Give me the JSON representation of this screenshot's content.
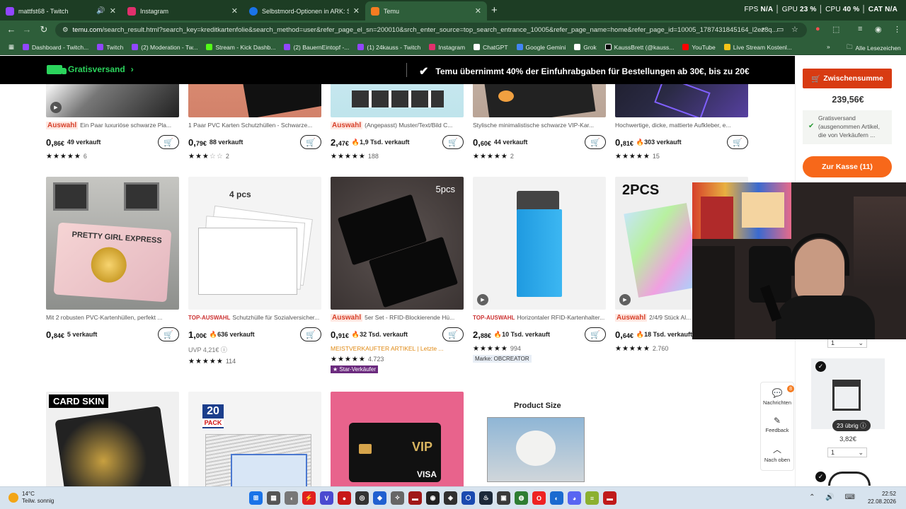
{
  "browser": {
    "tabs": [
      {
        "title": "mattfst68 - Twitch",
        "color": "#9146ff",
        "audio": true,
        "active": false
      },
      {
        "title": "Instagram",
        "color": "#e1306c",
        "audio": false,
        "active": false
      },
      {
        "title": "Selbstmord-Optionen in ARK: Su",
        "color": "#1a73e8",
        "audio": false,
        "active": false
      },
      {
        "title": "Temu",
        "color": "#f57c21",
        "audio": false,
        "active": true
      }
    ],
    "new_tab": "+",
    "perf": {
      "fps_label": "FPS",
      "fps": "N/A",
      "gpu_label": "GPU",
      "gpu": "23 %",
      "cpu_label": "CPU",
      "cpu": "40 %",
      "extra": "CAT N/A"
    },
    "url_host": "temu.com",
    "url_path": "/search_result.html?search_key=kreditkartenfolie&search_method=user&refer_page_el_sn=200010&srch_enter_source=top_search_entrance_10005&refer_page_name=home&refer_page_id=10005_1787431845164_l2ez8q...",
    "bookmarks": [
      {
        "label": "Dashboard - Twitch...",
        "color": "#9146ff"
      },
      {
        "label": "Twitch",
        "color": "#9146ff"
      },
      {
        "label": "(2) Moderation - Tw...",
        "color": "#9146ff"
      },
      {
        "label": "Stream - Kick Dashb...",
        "color": "#53fc18"
      },
      {
        "label": "(2) BauernEintopf -...",
        "color": "#9146ff"
      },
      {
        "label": "(1) 24kauss - Twitch",
        "color": "#9146ff"
      },
      {
        "label": "Instagram",
        "color": "#e1306c"
      },
      {
        "label": "ChatGPT",
        "color": "#ffffff"
      },
      {
        "label": "Google Gemini",
        "color": "#4285f4"
      },
      {
        "label": "Grok",
        "color": "#ffffff"
      },
      {
        "label": "KaussBrett (@kauss...",
        "color": "#000000"
      },
      {
        "label": "YouTube",
        "color": "#ff0000"
      },
      {
        "label": "Live Stream Kostenl...",
        "color": "#f5c518"
      }
    ],
    "bookmarks_more": "»",
    "all_bookmarks": "Alle Lesezeichen"
  },
  "banner": {
    "shipping": "Gratisversand",
    "promo": "Temu übernimmt 40% der Einfuhrabgaben für Bestellungen ab 30€, bis zu 20€"
  },
  "products_row1": [
    {
      "tag": "Auswahl",
      "title": "Ein Paar luxuriöse schwarze Pla...",
      "price_int": "0,",
      "price_dec": "86€",
      "sold": "49 verkauft",
      "stars": 5,
      "count": "6"
    },
    {
      "tag": "",
      "title": "1 Paar PVC Karten Schutzhüllen - Schwarze...",
      "price_int": "0,",
      "price_dec": "79€",
      "sold": "88 verkauft",
      "stars": 3,
      "count": "2"
    },
    {
      "tag": "Auswahl",
      "title": "(Angepasst) Muster/Text/Bild C...",
      "price_int": "2,",
      "price_dec": "47€",
      "sold": "1,9 Tsd. verkauft",
      "stars": 5,
      "count": "188"
    },
    {
      "tag": "",
      "title": "Stylische minimalistische schwarze VIP-Kar...",
      "price_int": "0,",
      "price_dec": "60€",
      "sold": "44 verkauft",
      "stars": 5,
      "count": "2"
    },
    {
      "tag": "",
      "title": "Hochwertige, dicke, mattierte Aufkleber, e...",
      "price_int": "0,",
      "price_dec": "81€",
      "sold": "303 verkauft",
      "stars": 5,
      "count": "15"
    }
  ],
  "products_row2": [
    {
      "tag": "",
      "title": "Mit 2 robusten PVC-Kartenhüllen, perfekt ...",
      "price_int": "0,",
      "price_dec": "84€",
      "sold": "5 verkauft",
      "stars": 0,
      "count": "",
      "overlay": "PRETTY GIRL EXPRESS"
    },
    {
      "tag": "TOP-AUSWAHL",
      "title": "Schutzhülle für Sozialversicher...",
      "price_int": "1,",
      "price_dec": "00€",
      "sold": "636 verkauft",
      "stars": 5,
      "count": "114",
      "uvp": "UVP 4,21€",
      "overlay": "4 pcs"
    },
    {
      "tag": "Auswahl",
      "title": "5er Set - RFID-Blockierende Hü...",
      "price_int": "0,",
      "price_dec": "91€",
      "sold": "32 Tsd. verkauft",
      "stars": 5,
      "count": "4.723",
      "best": "MEISTVERKAUFTER ARTIKEL | Letzte ...",
      "badge": "Star-Verkäufer",
      "overlay": "5pcs"
    },
    {
      "tag": "TOP-AUSWAHL",
      "title": "Horizontaler RFID-Kartenhalter...",
      "price_int": "2,",
      "price_dec": "88€",
      "sold": "10 Tsd. verkauft",
      "stars": 5,
      "count": "994",
      "brand": "Marke: OBCREATOR"
    },
    {
      "tag": "Auswahl",
      "title": "2/4/9 Stück Al...",
      "price_int": "0,",
      "price_dec": "64€",
      "sold": "18 Tsd. verkauft",
      "stars": 5,
      "count": "2.760",
      "overlay": "2PCS"
    }
  ],
  "products_row3": [
    {
      "overlay": "CARD SKIN"
    },
    {
      "overlay": "20",
      "overlay2": "PACK"
    },
    {
      "overlay": "VIP",
      "overlay2": "VISA"
    },
    {
      "overlay": "Product Size"
    }
  ],
  "sidebar": {
    "subtotal_label": "Zwischensumme",
    "subtotal": "239,56€",
    "free_shipping": "Gratisversand (ausgenommen Artikel, die von Verkäufern ...",
    "checkout": "Zur Kasse (11)",
    "qty1": "1",
    "remaining": "23 übrig",
    "item_price": "3,82€",
    "qty2": "1"
  },
  "float_menu": {
    "messages": "Nachrichten",
    "messages_count": "8",
    "feedback": "Feedback",
    "top": "Nach oben"
  },
  "taskbar": {
    "temp": "14°C",
    "weather": "Teilw. sonnig",
    "time": "22:52",
    "date": "22.08.2026"
  }
}
